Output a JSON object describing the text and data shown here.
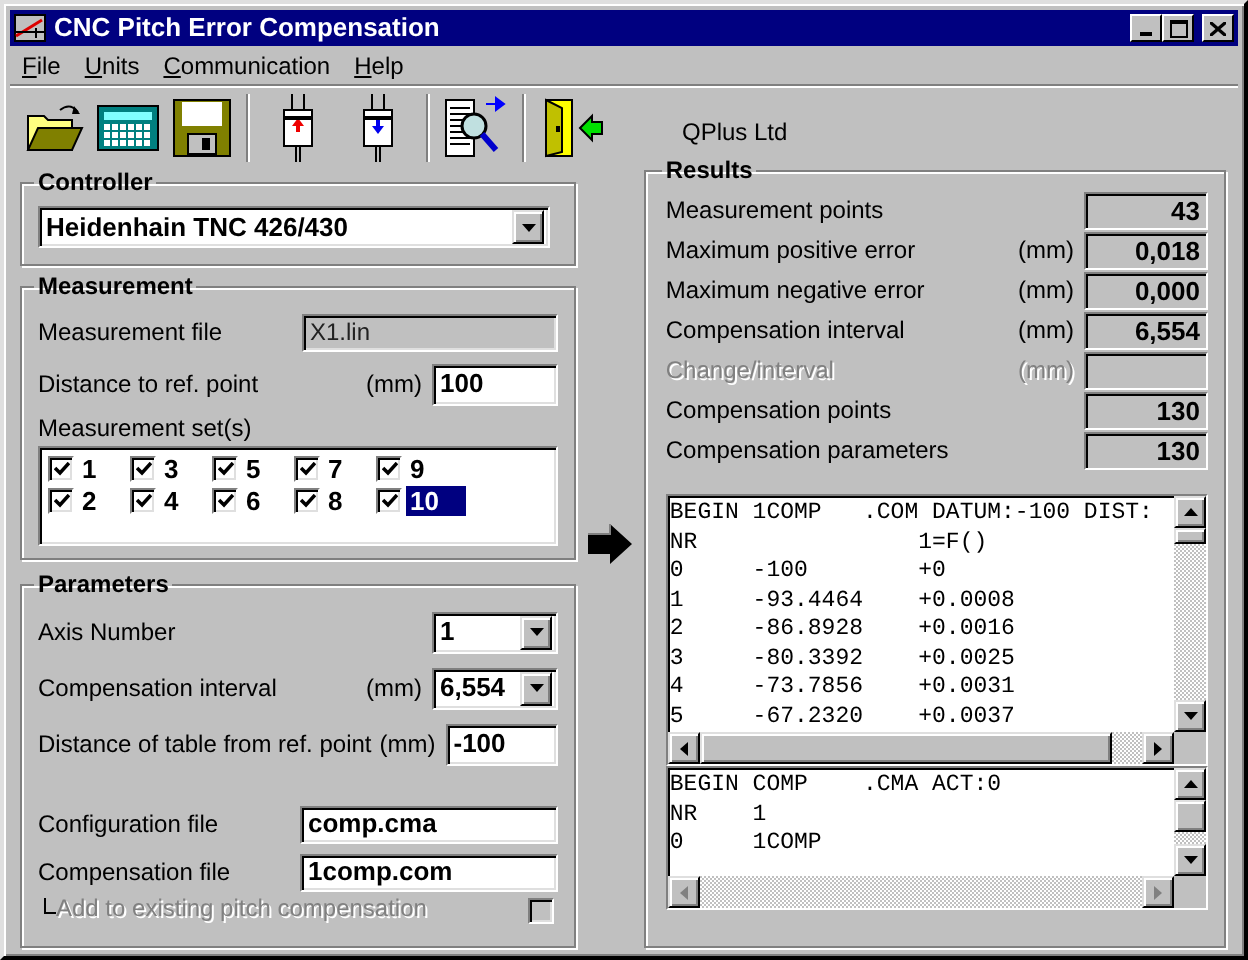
{
  "window": {
    "title": "CNC Pitch Error Compensation"
  },
  "menu": [
    "File",
    "Units",
    "Communication",
    "Help"
  ],
  "company": "QPlus Ltd",
  "controller": {
    "title": "Controller",
    "value": "Heidenhain TNC 426/430"
  },
  "measurement": {
    "title": "Measurement",
    "file_label": "Measurement file",
    "file_value": "X1.lin",
    "distance_label": "Distance to ref. point",
    "distance_unit": "(mm)",
    "distance_value": "100",
    "sets_label": "Measurement set(s)",
    "sets": [
      {
        "label": "1",
        "checked": true,
        "selected": false
      },
      {
        "label": "2",
        "checked": true,
        "selected": false
      },
      {
        "label": "3",
        "checked": true,
        "selected": false
      },
      {
        "label": "4",
        "checked": true,
        "selected": false
      },
      {
        "label": "5",
        "checked": true,
        "selected": false
      },
      {
        "label": "6",
        "checked": true,
        "selected": false
      },
      {
        "label": "7",
        "checked": true,
        "selected": false
      },
      {
        "label": "8",
        "checked": true,
        "selected": false
      },
      {
        "label": "9",
        "checked": true,
        "selected": false
      },
      {
        "label": "10",
        "checked": true,
        "selected": true
      }
    ]
  },
  "parameters": {
    "title": "Parameters",
    "fields": [
      {
        "kind": "combo",
        "label": "Axis Number",
        "value": "1"
      },
      {
        "kind": "combo",
        "label": "Compensation interval",
        "unit": "(mm)",
        "value": "6,554"
      },
      {
        "kind": "input",
        "label": "Distance of table from ref. point",
        "unit": "(mm)",
        "value": "-100"
      },
      {
        "kind": "file",
        "label": "Configuration file",
        "value": "comp.cma"
      },
      {
        "kind": "file",
        "label": "Compensation file",
        "value": "1comp.com"
      }
    ],
    "add_existing": {
      "label": "Add to existing pitch compensation",
      "checked": false,
      "disabled": true
    }
  },
  "results": {
    "title": "Results",
    "rows": [
      {
        "label": "Measurement points",
        "value": "43",
        "disabled": false
      },
      {
        "label": "Maximum positive error",
        "unit": "(mm)",
        "value": "0,018",
        "disabled": false
      },
      {
        "label": "Maximum negative error",
        "unit": "(mm)",
        "value": "0,000",
        "disabled": false
      },
      {
        "label": "Compensation interval",
        "unit": "(mm)",
        "value": "6,554",
        "disabled": false
      },
      {
        "label": "Change/interval",
        "unit": "(mm)",
        "disabled": true
      },
      {
        "label": "Compensation points",
        "value": "130",
        "disabled": false
      },
      {
        "label": "Compensation parameters",
        "value": "130",
        "disabled": false
      }
    ],
    "listing": [
      "BEGIN 1COMP   .COM DATUM:-100 DIST:",
      "NR                1=F()",
      "0     -100        +0",
      "1     -93.4464    +0.0008",
      "2     -86.8928    +0.0016",
      "3     -80.3392    +0.0025",
      "4     -73.7856    +0.0031",
      "5     -67.2320    +0.0037"
    ],
    "config_listing": [
      "BEGIN COMP    .CMA ACT:0",
      "NR    1",
      "0     1COMP"
    ]
  }
}
